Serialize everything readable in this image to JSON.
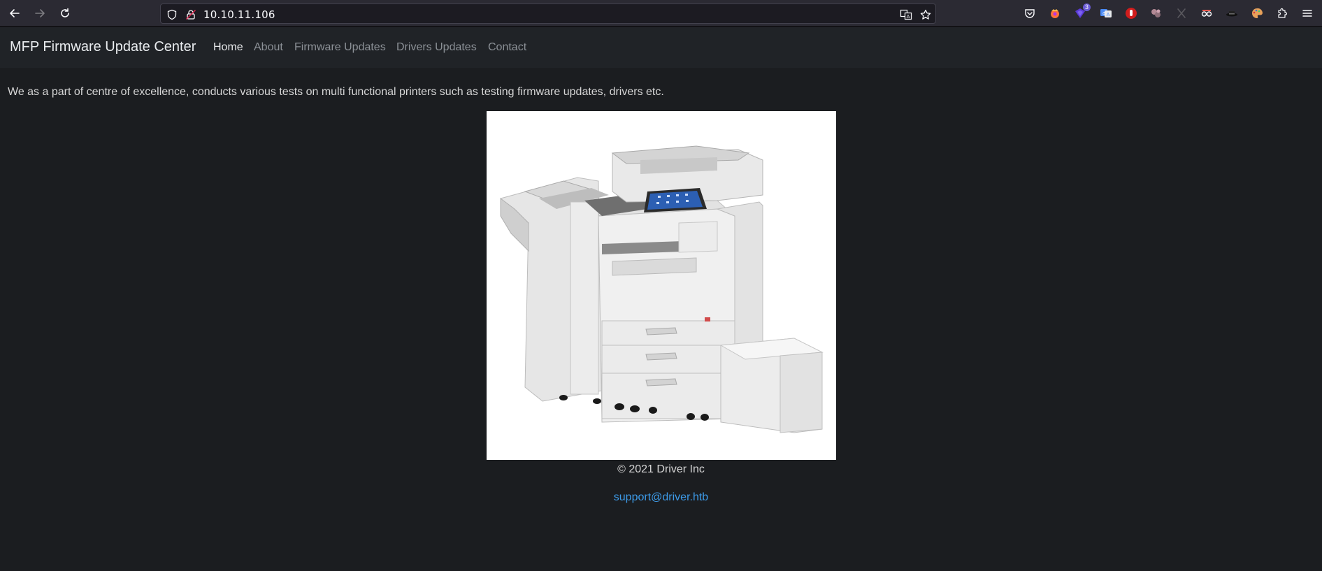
{
  "browser": {
    "url": "10.10.11.106",
    "extension_badge_count": "3",
    "extensions": [
      "pocket-icon",
      "firefox-relay-icon",
      "mask-extension-icon",
      "translate-extension-icon",
      "ublock-icon",
      "cookie-extension-icon",
      "disabled-x-icon",
      "spy-glasses-icon",
      "hat-icon",
      "palette-icon",
      "puzzle-extensions-icon",
      "hamburger-menu-icon"
    ]
  },
  "site": {
    "brand": "MFP Firmware Update Center",
    "nav": [
      "Home",
      "About",
      "Firmware Updates",
      "Drivers Updates",
      "Contact"
    ],
    "active_nav": "Home"
  },
  "main": {
    "intro": "We as a part of centre of excellence, conducts various tests on multi functional printers such as testing firmware updates, drivers etc.",
    "image_alt": "multi-functional-printer"
  },
  "footer": {
    "copyright": "© 2021 Driver Inc",
    "email": "support@driver.htb"
  },
  "colors": {
    "page_bg": "#1b1d20",
    "navbar_bg": "#202327",
    "link": "#3d9be9"
  }
}
